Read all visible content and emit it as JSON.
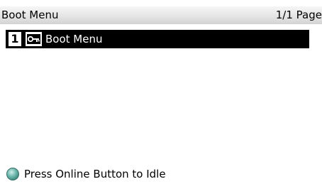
{
  "header": {
    "title": "Boot Menu",
    "page_indicator": "1/1 Page"
  },
  "menu": {
    "items": [
      {
        "number": "1",
        "icon": "key-icon",
        "label": "Boot Menu",
        "selected": true
      }
    ]
  },
  "status": {
    "icon": "online-led-icon",
    "message": "Press Online Button to Idle",
    "led_color": "#5aa9a0"
  },
  "colors": {
    "selection_background": "#000000",
    "selection_text": "#ffffff",
    "header_background": "#e3e3e3"
  }
}
